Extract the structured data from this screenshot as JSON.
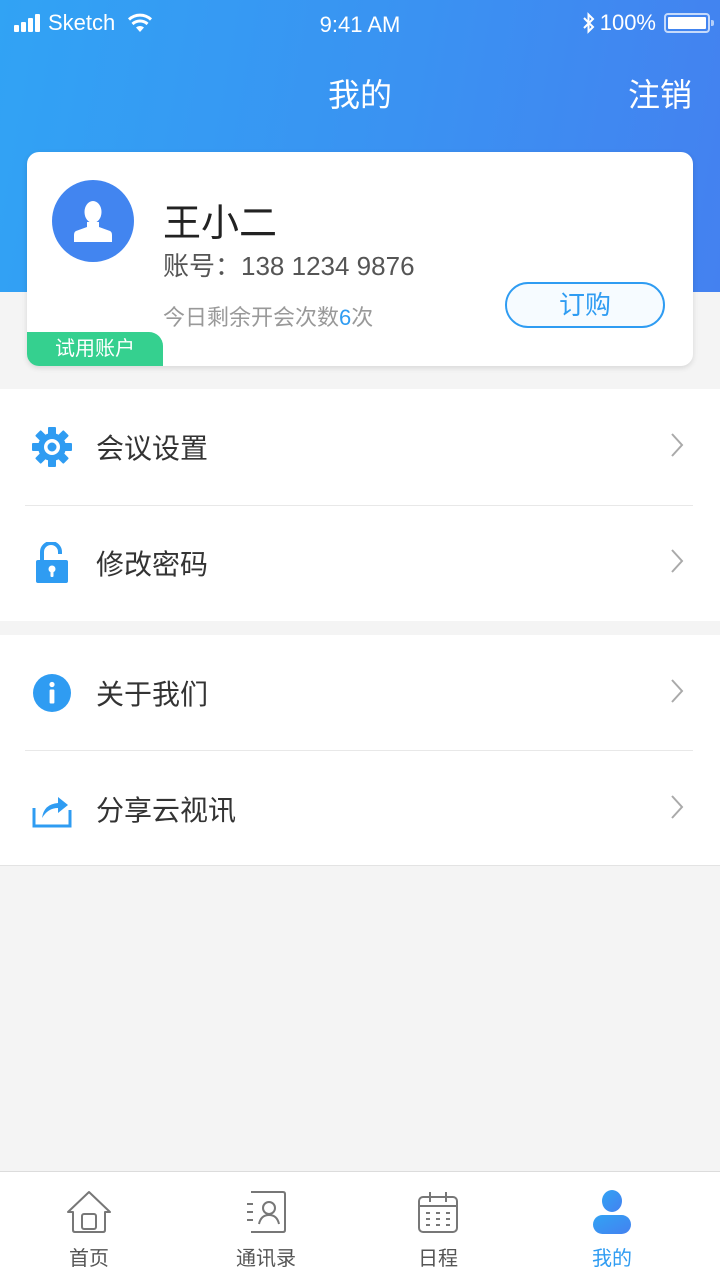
{
  "status_bar": {
    "carrier": "Sketch",
    "time": "9:41 AM",
    "battery": "100%"
  },
  "nav": {
    "title": "我的",
    "logout_label": "注销"
  },
  "profile": {
    "name": "王小二",
    "account_label": "账号：",
    "account_number": "138 1234 9876",
    "remaining_prefix": "今日剩余开会次数",
    "remaining_count": "6",
    "remaining_suffix": "次",
    "subscribe_label": "订购",
    "badge": "试用账户"
  },
  "menu": {
    "group1": [
      {
        "label": "会议设置",
        "icon": "gear-icon"
      },
      {
        "label": "修改密码",
        "icon": "unlock-icon"
      }
    ],
    "group2": [
      {
        "label": "关于我们",
        "icon": "info-icon"
      },
      {
        "label": "分享云视讯",
        "icon": "share-icon"
      }
    ]
  },
  "tab_bar": {
    "tabs": [
      {
        "label": "首页",
        "icon": "home-icon",
        "active": false
      },
      {
        "label": "通讯录",
        "icon": "contacts-icon",
        "active": false
      },
      {
        "label": "日程",
        "icon": "calendar-icon",
        "active": false
      },
      {
        "label": "我的",
        "icon": "user-icon",
        "active": true
      }
    ]
  },
  "colors": {
    "accent": "#2f9cf2",
    "header_gradient_start": "#31a3f4",
    "header_gradient_end": "#4481f0",
    "avatar_bg": "#4285f0",
    "trial_badge": "#35d08f"
  }
}
